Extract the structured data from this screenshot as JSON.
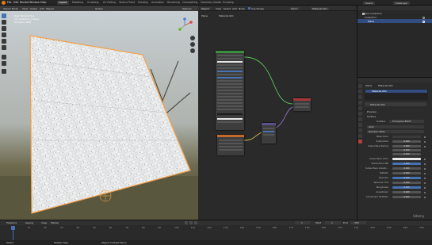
{
  "menus": [
    "File",
    "Edit",
    "Render",
    "Window",
    "Help"
  ],
  "workspaces": [
    "Layout",
    "Modeling",
    "Sculpting",
    "UV Editing",
    "Texture Paint",
    "Shading",
    "Animation",
    "Rendering",
    "Compositing",
    "Geometry Nodes",
    "Scripting"
  ],
  "active_workspace": "Layout",
  "scene_label": "Scene",
  "view_layer_label": "ViewLayer",
  "viewport": {
    "mode": "Object Mode",
    "menus": [
      "View",
      "Select",
      "Add",
      "Object"
    ],
    "orientation": "Global",
    "options": "Options",
    "overlay_lines": [
      "User Perspective",
      "(1) Collection | Plane",
      "Samples 4096"
    ]
  },
  "node_editor": {
    "mode": "Object",
    "menus": [
      "View",
      "Select",
      "Add",
      "Node"
    ],
    "use_nodes": "Use Nodes",
    "slot": "Slot 1",
    "material": "Material.001",
    "breadcrumb": [
      "Plane",
      "Material.001"
    ],
    "colors": {
      "wire_green": "#57c45a",
      "wire_yellow": "#d8c24a",
      "wire_purple": "#8c74c8",
      "node_shader": "#3b8d3f",
      "node_output": "#a53838",
      "node_texture": "#c46a2b"
    }
  },
  "outliner": {
    "title": "Scene Collection",
    "items": [
      "Collection",
      "Plane"
    ]
  },
  "properties": {
    "object": "Plane",
    "material": "Material.001",
    "material_slot": "Material.001",
    "sections": [
      "Preview",
      "Surface"
    ],
    "surface_label": "Surface",
    "surface_value": "Principled BSDF",
    "distribution": "GGX",
    "subsurface_method": "Random Walk",
    "rows": [
      {
        "label": "Base Color",
        "value": ""
      },
      {
        "label": "Subsurface",
        "value": "0.000"
      },
      {
        "label": "Subsurface Radius",
        "value": "1.000"
      },
      {
        "label": "",
        "value": "0.200"
      },
      {
        "label": "",
        "value": "0.100"
      },
      {
        "label": "Subsurface Color",
        "value": ""
      },
      {
        "label": "Subsurface IOR",
        "value": "1.400"
      },
      {
        "label": "Subsurface Anisotr...",
        "value": "0.000"
      },
      {
        "label": "Metallic",
        "value": "0.000"
      },
      {
        "label": "Specular",
        "value": "0.500"
      },
      {
        "label": "Specular Tint",
        "value": "0.000"
      },
      {
        "label": "Roughness",
        "value": "0.500"
      },
      {
        "label": "Anisotropic",
        "value": "0.000"
      },
      {
        "label": "Anisotropic Rotation",
        "value": "0.000"
      }
    ]
  },
  "timeline": {
    "menus": [
      "Playback",
      "Keying",
      "View",
      "Marker"
    ],
    "start_label": "Start",
    "start": "1",
    "end_label": "End",
    "end": "250",
    "current": "1",
    "ticks": [
      "0",
      "10",
      "20",
      "30",
      "40",
      "50",
      "60",
      "70",
      "80",
      "90",
      "100",
      "110",
      "120",
      "130",
      "140",
      "150",
      "160",
      "170",
      "180",
      "190",
      "200",
      "210",
      "220",
      "230",
      "240",
      "250"
    ],
    "status_left": "Select",
    "status_mid": "Rotate View",
    "status_right": "Object Context Menu"
  },
  "watermark": "Udemy"
}
